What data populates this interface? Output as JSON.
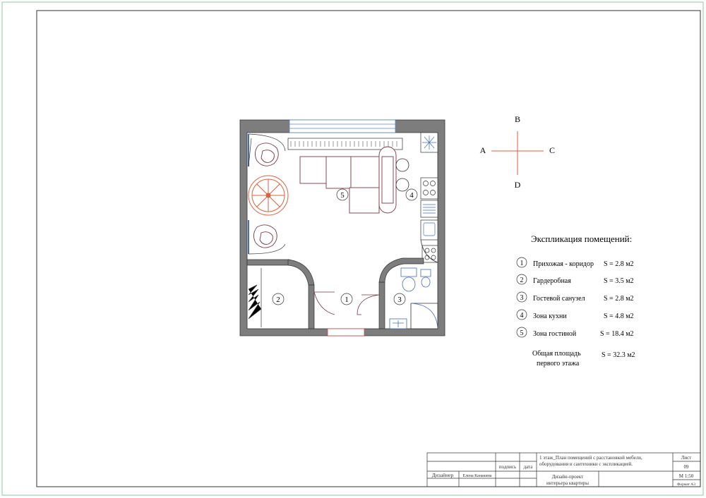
{
  "compass": {
    "north": "B",
    "west": "A",
    "east": "C",
    "south": "D"
  },
  "plan_room_numbers": [
    "1",
    "2",
    "3",
    "4",
    "5"
  ],
  "explication": {
    "title": "Экспликация помещений:",
    "rooms": [
      {
        "num": "1",
        "name": "Прихожая - коридор",
        "area": "S = 2.8 м2"
      },
      {
        "num": "2",
        "name": "Гардеробная",
        "area": "S = 3.5 м2"
      },
      {
        "num": "3",
        "name": "Гостевой санузел",
        "area": "S = 2.8 м2"
      },
      {
        "num": "4",
        "name": "Зона кухни",
        "area": "S = 4.8 м2"
      },
      {
        "num": "5",
        "name": "Зона гостиной",
        "area": "S = 18.4 м2"
      }
    ],
    "total_label_line1": "Общая площадь",
    "total_label_line2": "первого этажа",
    "total_area": "S = 32.3 м2"
  },
  "title_block": {
    "signature_header": "подпись",
    "date_header": "дата",
    "designer_label": "Дизайнер",
    "designer_name": "Елена Канакина",
    "description_line1": "1 этаж_План помещений с расстановкой мебели,",
    "description_line2": "оборудования и сантехники с экспликацией.",
    "project_line1": "Дизайн-проект",
    "project_line2": "интерьера квартиры",
    "sheet_label": "Лист",
    "sheet_number": "09",
    "scale": "М 1:50",
    "format": "Формат А3"
  },
  "colors": {
    "frame_green": "#8fc9a4",
    "wall": "#444444",
    "furniture": "#7a3b46",
    "accent": "#d9623f",
    "plumbing": "#4a6fb0",
    "window": "#5a86c4"
  }
}
